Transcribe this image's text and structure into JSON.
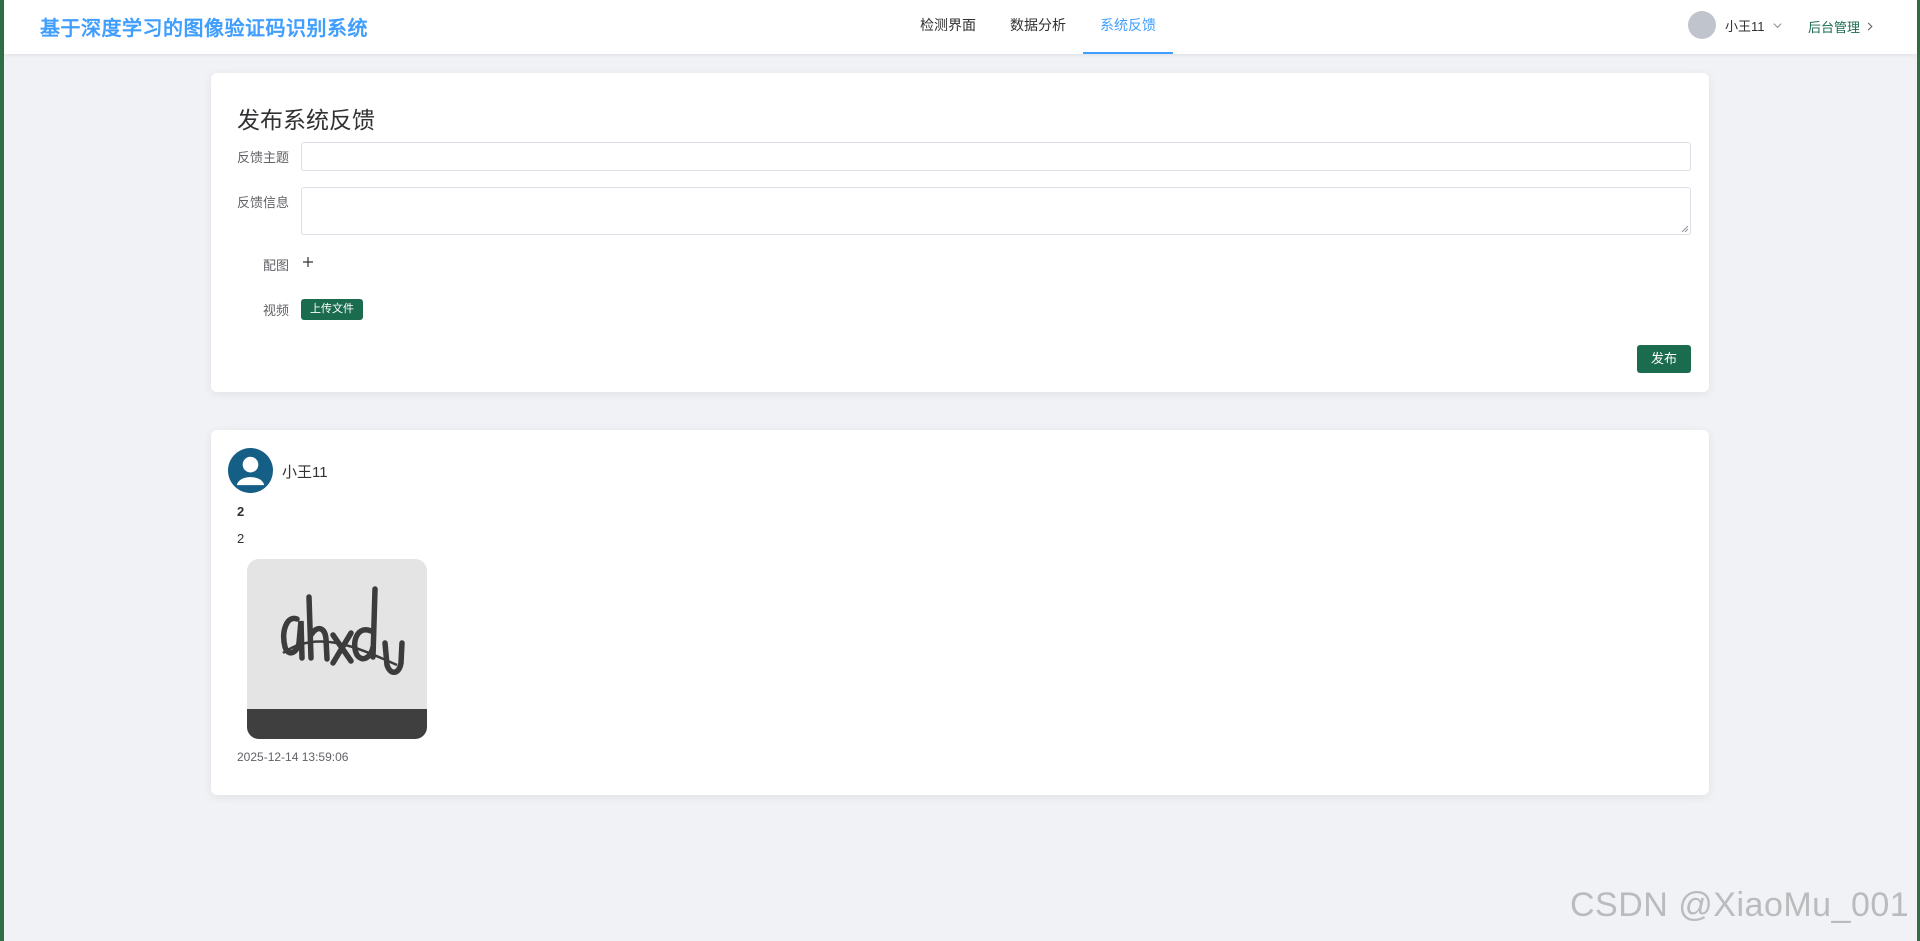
{
  "app": {
    "title": "基于深度学习的图像验证码识别系统",
    "accent_color": "#409eff",
    "primary_button_color": "#1b6b4f"
  },
  "nav": {
    "items": [
      {
        "label": "检测界面",
        "active": false
      },
      {
        "label": "数据分析",
        "active": false
      },
      {
        "label": "系统反馈",
        "active": true
      }
    ]
  },
  "user": {
    "name": "小王11",
    "admin_link": "后台管理"
  },
  "form": {
    "title": "发布系统反馈",
    "subject_label": "反馈主题",
    "subject_value": "",
    "message_label": "反馈信息",
    "message_value": "",
    "image_label": "配图",
    "video_label": "视频",
    "upload_label": "上传文件",
    "publish_label": "发布"
  },
  "posts": [
    {
      "user": "小王11",
      "title": "2",
      "body": "2",
      "image_icon": "captcha-image",
      "time": "2025-12-14 13:59:06"
    }
  ],
  "watermark": "CSDN @XiaoMu_001"
}
